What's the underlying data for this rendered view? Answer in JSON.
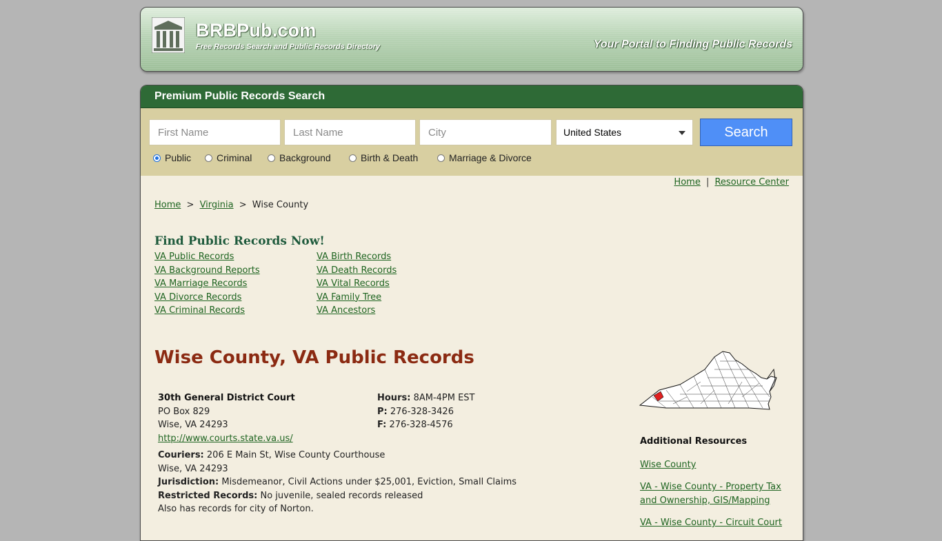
{
  "header": {
    "brand": "BRBPub.com",
    "brand_sub": "Free Records Search and Public Records Directory",
    "tagline": "Your Portal to Finding Public Records"
  },
  "search": {
    "title": "Premium Public Records Search",
    "first_name_placeholder": "First Name",
    "last_name_placeholder": "Last Name",
    "city_placeholder": "City",
    "country_selected": "United States",
    "button": "Search",
    "types": [
      {
        "label": "Public",
        "checked": true
      },
      {
        "label": "Criminal",
        "checked": false
      },
      {
        "label": "Background",
        "checked": false
      },
      {
        "label": "Birth & Death",
        "checked": false
      },
      {
        "label": "Marriage & Divorce",
        "checked": false
      }
    ]
  },
  "toplinks": {
    "home": "Home",
    "sep": "|",
    "resource": "Resource Center"
  },
  "breadcrumb": {
    "home": "Home",
    "state": "Virginia",
    "current": "Wise County",
    "sep": ">"
  },
  "find": {
    "title": "Find Public Records Now!",
    "col1": [
      "VA Public Records",
      "VA Background Reports",
      "VA Marriage Records",
      "VA Divorce Records",
      "VA Criminal Records"
    ],
    "col2": [
      "VA Birth Records",
      "VA Death Records",
      "VA Vital Records",
      "VA Family Tree",
      "VA Ancestors"
    ]
  },
  "county_title": "Wise County, VA Public Records",
  "court": {
    "name": "30th General District Court",
    "address1": "PO Box 829",
    "address2": "Wise, VA 24293",
    "url": "http://www.courts.state.va.us/",
    "hours_label": "Hours:",
    "hours": "8AM-4PM EST",
    "phone_label": "P:",
    "phone": "276-328-3426",
    "fax_label": "F:",
    "fax": "276-328-4576",
    "couriers_label": "Couriers:",
    "couriers": "206 E Main St, Wise County Courthouse",
    "couriers2": "Wise, VA 24293",
    "jurisdiction_label": "Jurisdiction:",
    "jurisdiction": "Misdemeanor, Civil Actions under $25,001, Eviction, Small Claims",
    "restricted_label": "Restricted Records:",
    "restricted": "No juvenile, sealed records released",
    "note": "Also has records for city of Norton."
  },
  "additional": {
    "title": "Additional Resources",
    "items": [
      "Wise County",
      "VA - Wise County - Property Tax and Ownership, GIS/Mapping",
      "VA - Wise County - Circuit Court"
    ]
  }
}
